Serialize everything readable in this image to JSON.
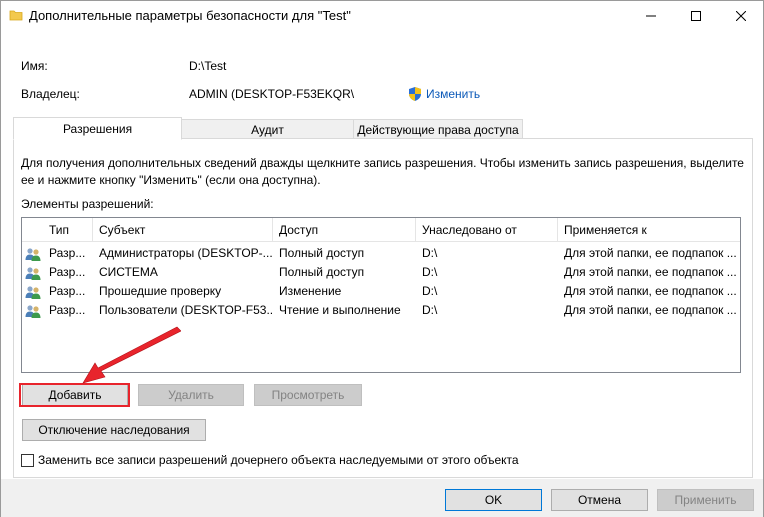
{
  "window": {
    "title": "Дополнительные параметры безопасности  для \"Test\"",
    "folder_icon": "folder-icon",
    "minimize_icon": "minimize-icon",
    "maximize_icon": "maximize-icon",
    "close_icon": "close-icon"
  },
  "info": {
    "name_label": "Имя:",
    "name_value": "D:\\Test",
    "owner_label": "Владелец:",
    "owner_value": "ADMIN (DESKTOP-F53EKQR\\",
    "change_label": "Изменить",
    "change_icon": "uac-shield-icon"
  },
  "tabs": [
    {
      "label": "Разрешения",
      "active": true
    },
    {
      "label": "Аудит",
      "active": false
    },
    {
      "label": "Действующие права доступа",
      "active": false
    }
  ],
  "help_text": "Для получения дополнительных сведений дважды щелкните запись разрешения. Чтобы изменить запись разрешения, выделите ее и нажмите кнопку \"Изменить\" (если она доступна).",
  "elements_label": "Элементы разрешений:",
  "table": {
    "columns": [
      "Тип",
      "Субъект",
      "Доступ",
      "Унаследовано от",
      "Применяется к"
    ],
    "rows": [
      {
        "type": "Разр...",
        "subject": "Администраторы (DESKTOP-...",
        "access": "Полный доступ",
        "inherited": "D:\\",
        "applies": "Для этой папки, ее подпапок ..."
      },
      {
        "type": "Разр...",
        "subject": "СИСТЕМА",
        "access": "Полный доступ",
        "inherited": "D:\\",
        "applies": "Для этой папки, ее подпапок ..."
      },
      {
        "type": "Разр...",
        "subject": "Прошедшие проверку",
        "access": "Изменение",
        "inherited": "D:\\",
        "applies": "Для этой папки, ее подпапок ..."
      },
      {
        "type": "Разр...",
        "subject": "Пользователи (DESKTOP-F53...",
        "access": "Чтение и выполнение",
        "inherited": "D:\\",
        "applies": "Для этой папки, ее подпапок ..."
      }
    ],
    "row_icon": "users-icon"
  },
  "buttons": {
    "add": "Добавить",
    "remove": "Удалить",
    "view": "Просмотреть",
    "disable_inheritance": "Отключение наследования"
  },
  "checkbox": {
    "label": "Заменить все записи разрешений дочернего объекта наследуемыми от этого объекта",
    "checked": false
  },
  "footer": {
    "ok": "OK",
    "cancel": "Отмена",
    "apply": "Применить"
  },
  "annotation": {
    "color": "#e8242c"
  }
}
